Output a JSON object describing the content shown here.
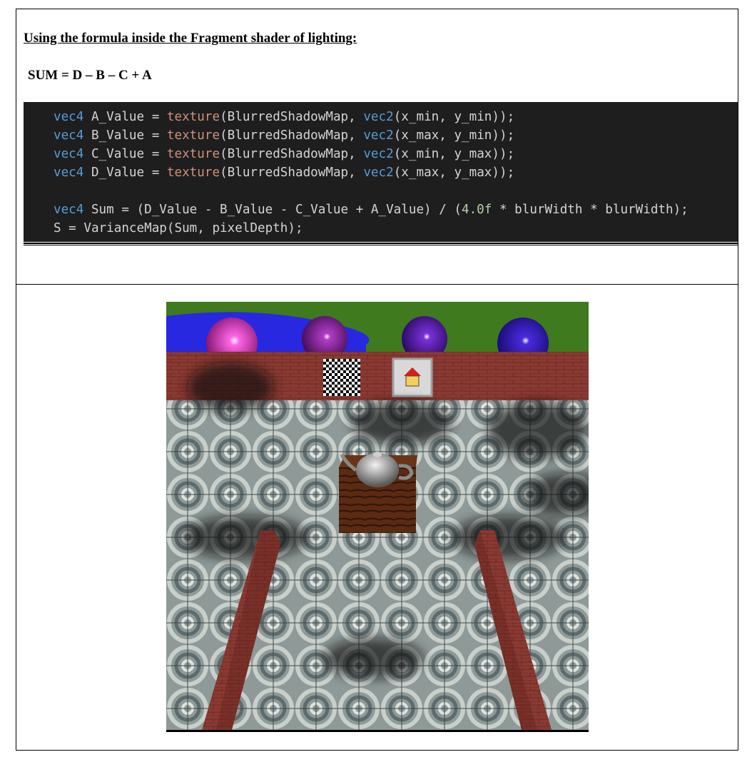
{
  "heading": "Using the formula inside the Fragment shader of lighting:",
  "formula": "SUM = D – B – C + A",
  "code": {
    "lines": [
      [
        {
          "t": "vec4",
          "c": "kw"
        },
        {
          "t": " A_Value = "
        },
        {
          "t": "texture",
          "c": "tx"
        },
        {
          "t": "(BlurredShadowMap, "
        },
        {
          "t": "vec2",
          "c": "kw"
        },
        {
          "t": "(x_min, y_min));"
        }
      ],
      [
        {
          "t": "vec4",
          "c": "kw"
        },
        {
          "t": " B_Value = "
        },
        {
          "t": "texture",
          "c": "tx"
        },
        {
          "t": "(BlurredShadowMap, "
        },
        {
          "t": "vec2",
          "c": "kw"
        },
        {
          "t": "(x_max, y_min));"
        }
      ],
      [
        {
          "t": "vec4",
          "c": "kw"
        },
        {
          "t": " C_Value = "
        },
        {
          "t": "texture",
          "c": "tx"
        },
        {
          "t": "(BlurredShadowMap, "
        },
        {
          "t": "vec2",
          "c": "kw"
        },
        {
          "t": "(x_min, y_max));"
        }
      ],
      [
        {
          "t": "vec4",
          "c": "kw"
        },
        {
          "t": " D_Value = "
        },
        {
          "t": "texture",
          "c": "tx"
        },
        {
          "t": "(BlurredShadowMap, "
        },
        {
          "t": "vec2",
          "c": "kw"
        },
        {
          "t": "(x_max, y_max));"
        }
      ],
      [],
      [
        {
          "t": "vec4",
          "c": "kw"
        },
        {
          "t": " Sum = (D_Value - B_Value - C_Value + A_Value) / ("
        },
        {
          "t": "4.0f",
          "c": "num"
        },
        {
          "t": " * blurWidth * blurWidth);"
        }
      ],
      [
        {
          "t": "S = VarianceMap(Sum, pixelDepth);"
        }
      ]
    ]
  },
  "scene": {
    "description_icon": "rendered-3d-scene",
    "sphere_colors": [
      "#e01fbf",
      "#8a1aa0",
      "#5a12b0",
      "#3a10b8"
    ],
    "sky_color": "#3f7a1f",
    "water_color": "#2828e0",
    "wall_color": "#8a3a32"
  }
}
